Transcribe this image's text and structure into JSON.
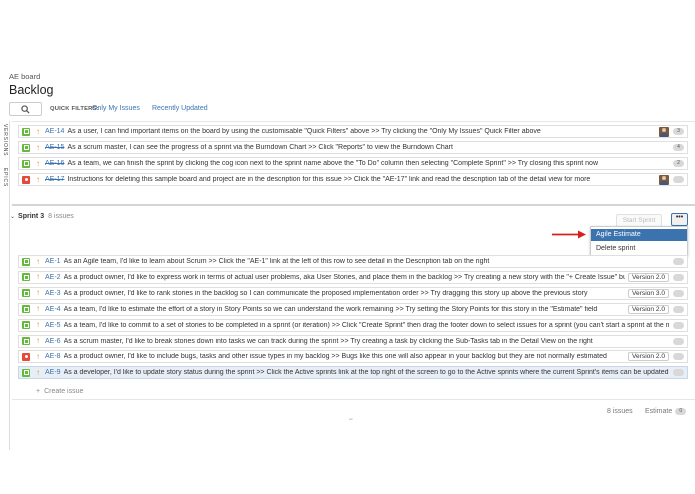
{
  "header": {
    "project_name": "AE board",
    "page_title": "Backlog"
  },
  "quick_filters": {
    "label": "QUICK FILTERS:",
    "items": [
      "Only My Issues",
      "Recently Updated"
    ]
  },
  "sidebar": {
    "tabs": [
      "VERSIONS",
      "EPICS"
    ]
  },
  "backlog_top": [
    {
      "type": "story",
      "key": "AE-14",
      "done": false,
      "summary": "As a user, I can find important items on the board by using the customisable \"Quick Filters\" above >> Try clicking the \"Only My Issues\" Quick Filter above",
      "avatar": true,
      "estimate": "3"
    },
    {
      "type": "story",
      "key": "AE-15",
      "done": true,
      "summary": "As a scrum master, I can see the progress of a sprint via the Burndown Chart >> Click \"Reports\" to view the Burndown Chart",
      "avatar": false,
      "estimate": "4"
    },
    {
      "type": "story",
      "key": "AE-16",
      "done": true,
      "summary": "As a team, we can finish the sprint by clicking the cog icon next to the sprint name above the \"To Do\" column then selecting \"Complete Sprint\" >> Try closing this sprint now",
      "avatar": false,
      "estimate": "2"
    },
    {
      "type": "bug",
      "key": "AE-17",
      "done": true,
      "summary": "Instructions for deleting this sample board and project are in the description for this issue >> Click the \"AE-17\" link and read the description tab of the detail view for more",
      "avatar": true,
      "estimate": ""
    }
  ],
  "sprint": {
    "name": "Sprint 3",
    "count": "8 issues",
    "start_label": "Start Sprint",
    "more_label": "•••",
    "menu": [
      "Agile Estimate",
      "Delete sprint"
    ],
    "issues": [
      {
        "type": "story",
        "key": "AE-1",
        "summary": "As an Agile team, I'd like to learn about Scrum >> Click the \"AE-1\" link at the left of this row to see detail in the Description tab on the right",
        "version": ""
      },
      {
        "type": "story",
        "key": "AE-2",
        "summary": "As a product owner, I'd like to express work in terms of actual user problems, aka User Stories, and place them in the backlog >> Try creating a new story with the \"+ Create Issue\" butto",
        "version": "Version 2.0"
      },
      {
        "type": "story",
        "key": "AE-3",
        "summary": "As a product owner, I'd like to rank stories in the backlog so I can communicate the proposed implementation order >> Try dragging this story up above the previous story",
        "version": "Version 3.0"
      },
      {
        "type": "story",
        "key": "AE-4",
        "summary": "As a team, I'd like to estimate the effort of a story in Story Points so we can understand the work remaining >> Try setting the Story Points for this story in the \"Estimate\" field",
        "version": "Version 2.0"
      },
      {
        "type": "story",
        "key": "AE-5",
        "summary": "As a team, I'd like to commit to a set of stories to be completed in a sprint (or iteration) >> Click \"Create Sprint\" then drag the footer down to select issues for a sprint (you can't start a sprint at the mo",
        "version": ""
      },
      {
        "type": "story",
        "key": "AE-6",
        "summary": "As a scrum master, I'd like to break stories down into tasks we can track during the sprint >> Try creating a task by clicking the Sub-Tasks tab in the Detail View on the right",
        "version": ""
      },
      {
        "type": "bug",
        "key": "AE-8",
        "summary": "As a product owner, I'd like to include bugs, tasks and other issue types in my backlog >> Bugs like this one will also appear in your backlog but they are not normally estimated",
        "version": "Version 2.0"
      },
      {
        "type": "story",
        "key": "AE-9",
        "summary": "As a developer, I'd like to update story status during the sprint >> Click the Active sprints link at the top right of the screen to go to the Active sprints where the current Sprint's items can be updated",
        "version": ""
      }
    ],
    "create_issue": "Create issue",
    "footer_count": "8 issues",
    "footer_estimate": "Estimate",
    "footer_estimate_value": "0"
  },
  "colors": {
    "link": "#3b73af",
    "story": "#63ba3c",
    "bug": "#e5493a",
    "priority": "#e7902c",
    "annotation_arrow": "#d9201c"
  }
}
